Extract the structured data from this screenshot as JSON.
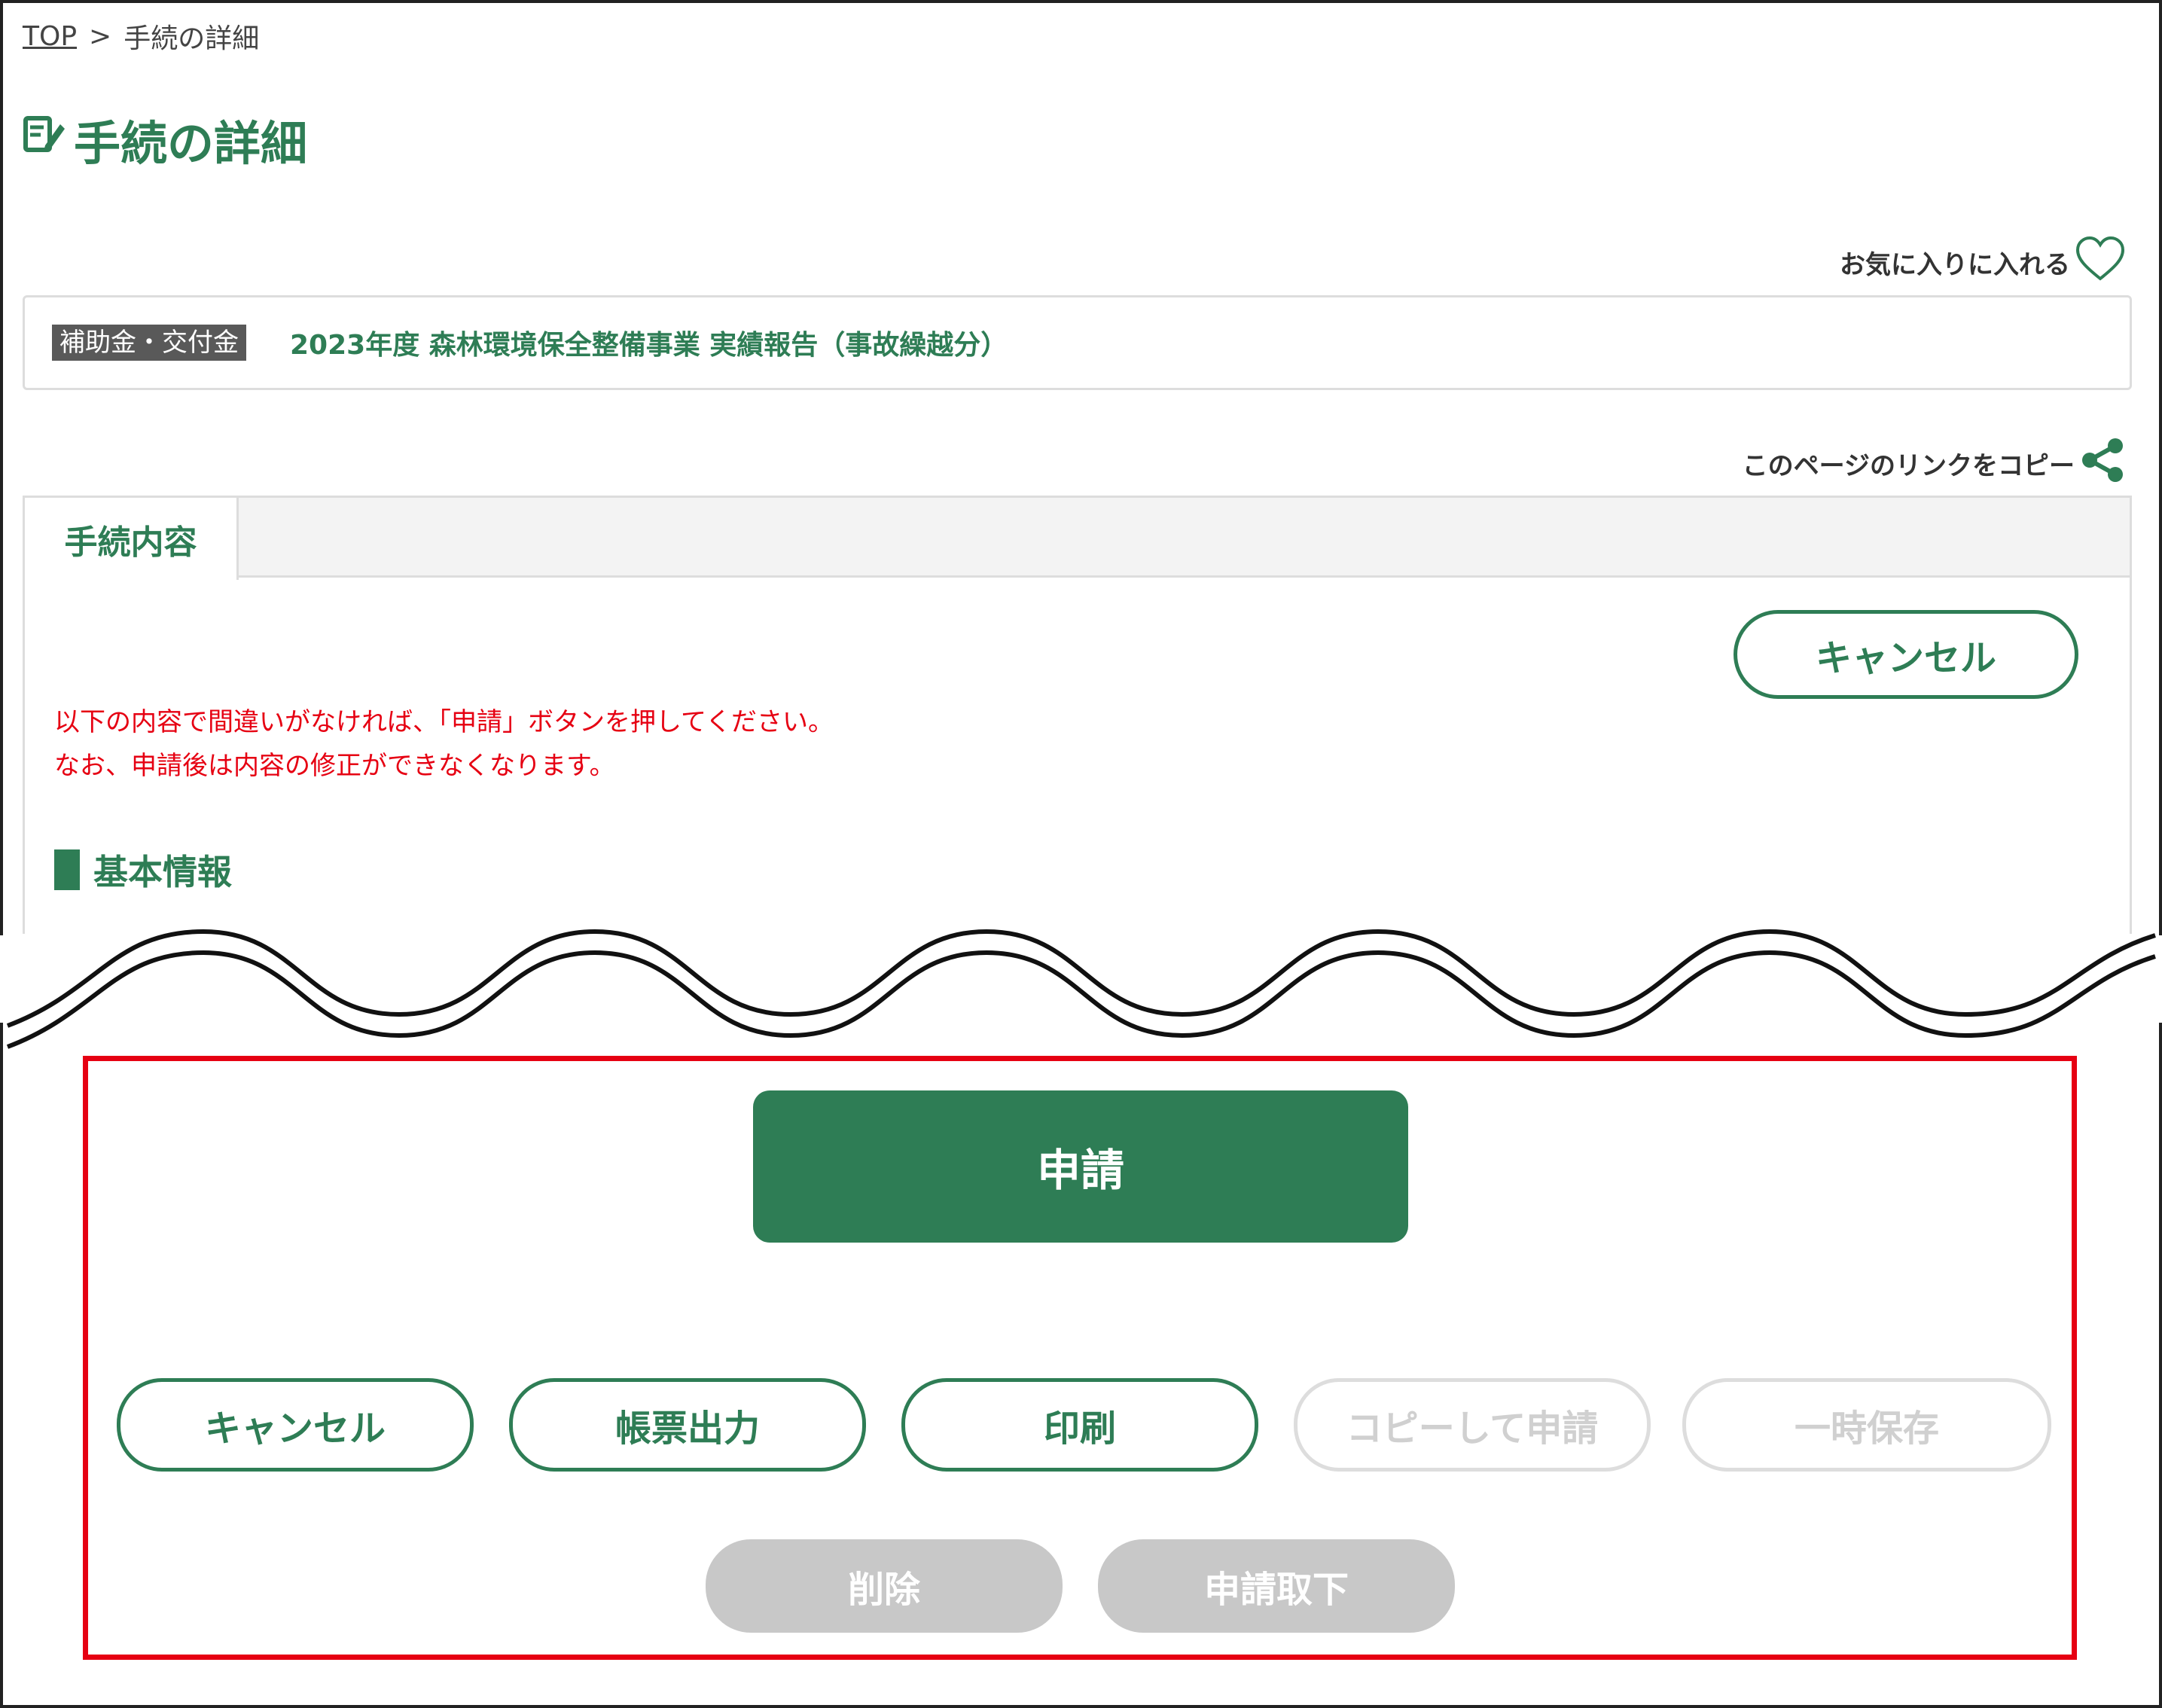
{
  "breadcrumb": {
    "top_label": "TOP",
    "separator": ">",
    "current": "手続の詳細"
  },
  "page": {
    "title": "手続の詳細"
  },
  "favorite": {
    "label": "お気に入りに入れる"
  },
  "procedure": {
    "category": "補助金・交付金",
    "name": "2023年度 森林環境保全整備事業 実績報告（事故繰越分）"
  },
  "copy_link": {
    "label": "このページのリンクをコピー"
  },
  "tab": {
    "label": "手続内容"
  },
  "top_cancel": {
    "label": "キャンセル"
  },
  "notice": {
    "line1": "以下の内容で間違いがなければ、「申請」ボタンを押してください。",
    "line2": "なお、申請後は内容の修正ができなくなります。"
  },
  "section": {
    "heading": "基本情報"
  },
  "actions": {
    "apply": "申請",
    "cancel": "キャンセル",
    "form_output": "帳票出力",
    "print": "印刷",
    "copy_apply": "コピーして申請",
    "temp_save": "一時保存",
    "delete": "削除",
    "withdraw": "申請取下"
  },
  "colors": {
    "accent": "#2e7d55",
    "alert": "#e60012",
    "disabled": "#c8c8c8",
    "badge": "#595959"
  }
}
